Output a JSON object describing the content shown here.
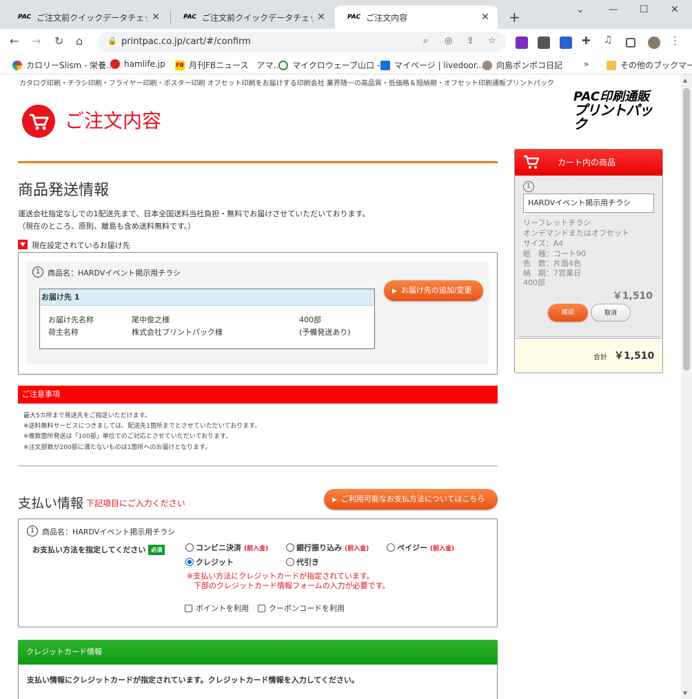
{
  "browser": {
    "tabs": [
      {
        "favicon": "PAC",
        "title": "ご注文前クイックデータチェック　サービ"
      },
      {
        "favicon": "PAC",
        "title": "ご注文前クイックデータチェック　サービ"
      },
      {
        "favicon": "PAC",
        "title": "ご注文内容"
      }
    ],
    "url": "printpac.co.jp/cart/#/confirm",
    "bookmarks": [
      "カロリーSlism - 栄養...",
      "hamlife.jp",
      "月刊FBニュース　アマ...",
      "マイクロウェーブ山口 -...",
      "マイページ | livedoor...",
      "向島ポンポコ日記",
      "その他のブックマーク"
    ],
    "icons": {
      "favicon_text_bm_fb": "FB",
      "ext_badge": "N",
      "overflow": "»"
    }
  },
  "header": {
    "tagline": "カタログ印刷・チラシ印刷・フライヤー印刷・ポスター印刷 オフセット印刷をお届けする印刷会社 業界随一の高品質・低価格＆短納期・オフセット印刷通販プリントパック",
    "title": "ご注文内容",
    "logo_line1": "PAC印刷通販",
    "logo_line2": "プリントパック"
  },
  "shipping": {
    "heading": "商品発送情報",
    "desc1": "運送会社指定なしでの1配送先まで、日本全国送料当社負担・無料でお届けさせていただいております。",
    "desc2": "（現在のところ、原則、離島も含め送料無料です。）",
    "current_label": "現在設定されているお届け先",
    "item_no": "1",
    "product": "商品名：HARDVイベント掲示用チラシ",
    "dest_title": "お届け先 1",
    "rows": [
      {
        "label": "お届け先名称",
        "value": "尾中俊之様",
        "qty": "400部"
      },
      {
        "label": "荷主名称",
        "value": "株式会社プリントパック様",
        "qty": "(予備発送あり)"
      }
    ],
    "change_button": "お届け先の追加/変更"
  },
  "notice": {
    "title": "ご注意事項",
    "lines": [
      "最大5カ所まで発送先をご指定いただけます。",
      "※送料無料サービスにつきましては、配送先1箇所までとさせていただいております。",
      "※複数箇所発送は「100部」単位でのご対応とさせていただいております。",
      "※注文部数が200部に満たないものは1箇所へのお届けとなります。"
    ]
  },
  "payment": {
    "heading": "支払い情報",
    "sub": "下記項目にご入力ください",
    "methods_button": "ご利用可能なお支払方法についてはこちら",
    "item_no": "1",
    "product": "商品名：HARDVイベント掲示用チラシ",
    "label": "お支払い方法を指定してください",
    "required": "必須",
    "options": [
      {
        "label": "コンビニ決済",
        "note": "(前入金)",
        "checked": false
      },
      {
        "label": "銀行振り込み",
        "note": "(前入金)",
        "checked": false
      },
      {
        "label": "ペイジー",
        "note": "(前入金)",
        "checked": false
      },
      {
        "label": "クレジット",
        "note": "",
        "checked": true
      },
      {
        "label": "代引き",
        "note": "",
        "checked": false
      }
    ],
    "warn1": "※支払い方法にクレジットカードが指定されています。",
    "warn2": "下部のクレジットカード情報フォームの入力が必要です。",
    "use_points": "ポイントを利用",
    "use_coupon": "クーポンコードを利用"
  },
  "credit": {
    "title": "クレジットカード情報",
    "text": "支払い情報にクレジットカードが指定されています。クレジットカード情報を入力してください。"
  },
  "cart": {
    "title": "カート内の商品",
    "item_no": "1",
    "name": "HARDVイベント掲示用チラシ",
    "specs": [
      "リーフレットチラシ",
      "オンデマンドまたはオフセット",
      "サイズ：A4",
      "紙　種：コート90",
      "色　数：片面4色",
      "納　期：7営業日",
      "400部"
    ],
    "price": "￥1,510",
    "confirm": "確認",
    "cancel": "取消",
    "total_label": "合計",
    "total": "￥1,510"
  },
  "colors": {
    "accent_red": "#e8141d",
    "orange": "#f07b1a",
    "green": "#129912"
  }
}
